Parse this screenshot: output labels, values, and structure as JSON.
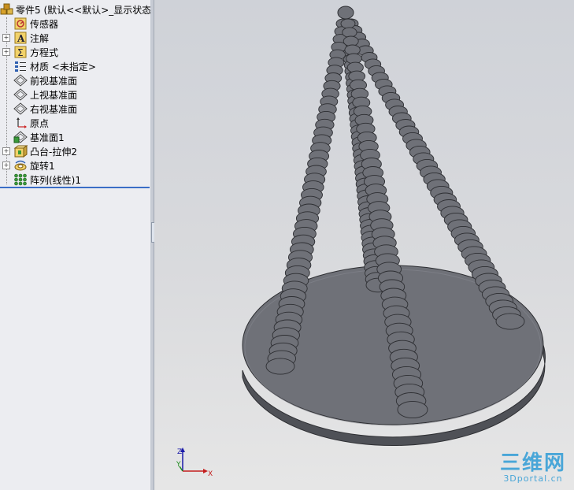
{
  "tree": {
    "root_label": "零件5  (默认<<默认>_显示状态",
    "items": [
      {
        "label": "传感器",
        "icon": "sensor-icon",
        "expandable": false
      },
      {
        "label": "注解",
        "icon": "annotation-icon",
        "expandable": true
      },
      {
        "label": "方程式",
        "icon": "equation-icon",
        "expandable": true
      },
      {
        "label": "材质 <未指定>",
        "icon": "material-icon",
        "expandable": false
      },
      {
        "label": "前视基准面",
        "icon": "plane-icon",
        "expandable": false
      },
      {
        "label": "上视基准面",
        "icon": "plane-icon",
        "expandable": false
      },
      {
        "label": "右视基准面",
        "icon": "plane-icon",
        "expandable": false
      },
      {
        "label": "原点",
        "icon": "origin-icon",
        "expandable": false
      },
      {
        "label": "基准面1",
        "icon": "plane-icon",
        "expandable": false
      },
      {
        "label": "凸台-拉伸2",
        "icon": "extrude-icon",
        "expandable": true
      },
      {
        "label": "旋转1",
        "icon": "revolve-icon",
        "expandable": true
      },
      {
        "label": "阵列(线性)1",
        "icon": "linear-pattern-icon",
        "expandable": false
      }
    ]
  },
  "triad": {
    "x_label": "X",
    "y_label": "Y",
    "z_label": "Z"
  },
  "watermark": {
    "big": "三维网",
    "small": "3Dportal.cn"
  },
  "colors": {
    "panel_bg": "#ecedf1",
    "selection_line": "#3a6ec6",
    "model_gray": "#6f7178",
    "model_dark": "#4f5157",
    "viewport_bg": "#d4d6da",
    "watermark": "#49a6d8"
  }
}
